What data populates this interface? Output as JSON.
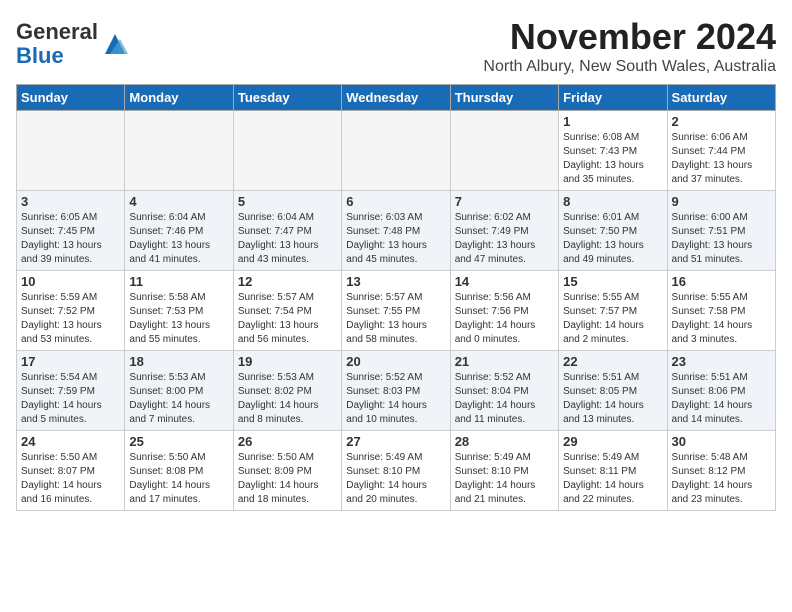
{
  "header": {
    "logo": {
      "general": "General",
      "blue": "Blue"
    },
    "title": "November 2024",
    "location": "North Albury, New South Wales, Australia"
  },
  "weekdays": [
    "Sunday",
    "Monday",
    "Tuesday",
    "Wednesday",
    "Thursday",
    "Friday",
    "Saturday"
  ],
  "weeks": [
    [
      {
        "day": "",
        "info": ""
      },
      {
        "day": "",
        "info": ""
      },
      {
        "day": "",
        "info": ""
      },
      {
        "day": "",
        "info": ""
      },
      {
        "day": "",
        "info": ""
      },
      {
        "day": "1",
        "info": "Sunrise: 6:08 AM\nSunset: 7:43 PM\nDaylight: 13 hours\nand 35 minutes."
      },
      {
        "day": "2",
        "info": "Sunrise: 6:06 AM\nSunset: 7:44 PM\nDaylight: 13 hours\nand 37 minutes."
      }
    ],
    [
      {
        "day": "3",
        "info": "Sunrise: 6:05 AM\nSunset: 7:45 PM\nDaylight: 13 hours\nand 39 minutes."
      },
      {
        "day": "4",
        "info": "Sunrise: 6:04 AM\nSunset: 7:46 PM\nDaylight: 13 hours\nand 41 minutes."
      },
      {
        "day": "5",
        "info": "Sunrise: 6:04 AM\nSunset: 7:47 PM\nDaylight: 13 hours\nand 43 minutes."
      },
      {
        "day": "6",
        "info": "Sunrise: 6:03 AM\nSunset: 7:48 PM\nDaylight: 13 hours\nand 45 minutes."
      },
      {
        "day": "7",
        "info": "Sunrise: 6:02 AM\nSunset: 7:49 PM\nDaylight: 13 hours\nand 47 minutes."
      },
      {
        "day": "8",
        "info": "Sunrise: 6:01 AM\nSunset: 7:50 PM\nDaylight: 13 hours\nand 49 minutes."
      },
      {
        "day": "9",
        "info": "Sunrise: 6:00 AM\nSunset: 7:51 PM\nDaylight: 13 hours\nand 51 minutes."
      }
    ],
    [
      {
        "day": "10",
        "info": "Sunrise: 5:59 AM\nSunset: 7:52 PM\nDaylight: 13 hours\nand 53 minutes."
      },
      {
        "day": "11",
        "info": "Sunrise: 5:58 AM\nSunset: 7:53 PM\nDaylight: 13 hours\nand 55 minutes."
      },
      {
        "day": "12",
        "info": "Sunrise: 5:57 AM\nSunset: 7:54 PM\nDaylight: 13 hours\nand 56 minutes."
      },
      {
        "day": "13",
        "info": "Sunrise: 5:57 AM\nSunset: 7:55 PM\nDaylight: 13 hours\nand 58 minutes."
      },
      {
        "day": "14",
        "info": "Sunrise: 5:56 AM\nSunset: 7:56 PM\nDaylight: 14 hours\nand 0 minutes."
      },
      {
        "day": "15",
        "info": "Sunrise: 5:55 AM\nSunset: 7:57 PM\nDaylight: 14 hours\nand 2 minutes."
      },
      {
        "day": "16",
        "info": "Sunrise: 5:55 AM\nSunset: 7:58 PM\nDaylight: 14 hours\nand 3 minutes."
      }
    ],
    [
      {
        "day": "17",
        "info": "Sunrise: 5:54 AM\nSunset: 7:59 PM\nDaylight: 14 hours\nand 5 minutes."
      },
      {
        "day": "18",
        "info": "Sunrise: 5:53 AM\nSunset: 8:00 PM\nDaylight: 14 hours\nand 7 minutes."
      },
      {
        "day": "19",
        "info": "Sunrise: 5:53 AM\nSunset: 8:02 PM\nDaylight: 14 hours\nand 8 minutes."
      },
      {
        "day": "20",
        "info": "Sunrise: 5:52 AM\nSunset: 8:03 PM\nDaylight: 14 hours\nand 10 minutes."
      },
      {
        "day": "21",
        "info": "Sunrise: 5:52 AM\nSunset: 8:04 PM\nDaylight: 14 hours\nand 11 minutes."
      },
      {
        "day": "22",
        "info": "Sunrise: 5:51 AM\nSunset: 8:05 PM\nDaylight: 14 hours\nand 13 minutes."
      },
      {
        "day": "23",
        "info": "Sunrise: 5:51 AM\nSunset: 8:06 PM\nDaylight: 14 hours\nand 14 minutes."
      }
    ],
    [
      {
        "day": "24",
        "info": "Sunrise: 5:50 AM\nSunset: 8:07 PM\nDaylight: 14 hours\nand 16 minutes."
      },
      {
        "day": "25",
        "info": "Sunrise: 5:50 AM\nSunset: 8:08 PM\nDaylight: 14 hours\nand 17 minutes."
      },
      {
        "day": "26",
        "info": "Sunrise: 5:50 AM\nSunset: 8:09 PM\nDaylight: 14 hours\nand 18 minutes."
      },
      {
        "day": "27",
        "info": "Sunrise: 5:49 AM\nSunset: 8:10 PM\nDaylight: 14 hours\nand 20 minutes."
      },
      {
        "day": "28",
        "info": "Sunrise: 5:49 AM\nSunset: 8:10 PM\nDaylight: 14 hours\nand 21 minutes."
      },
      {
        "day": "29",
        "info": "Sunrise: 5:49 AM\nSunset: 8:11 PM\nDaylight: 14 hours\nand 22 minutes."
      },
      {
        "day": "30",
        "info": "Sunrise: 5:48 AM\nSunset: 8:12 PM\nDaylight: 14 hours\nand 23 minutes."
      }
    ]
  ]
}
